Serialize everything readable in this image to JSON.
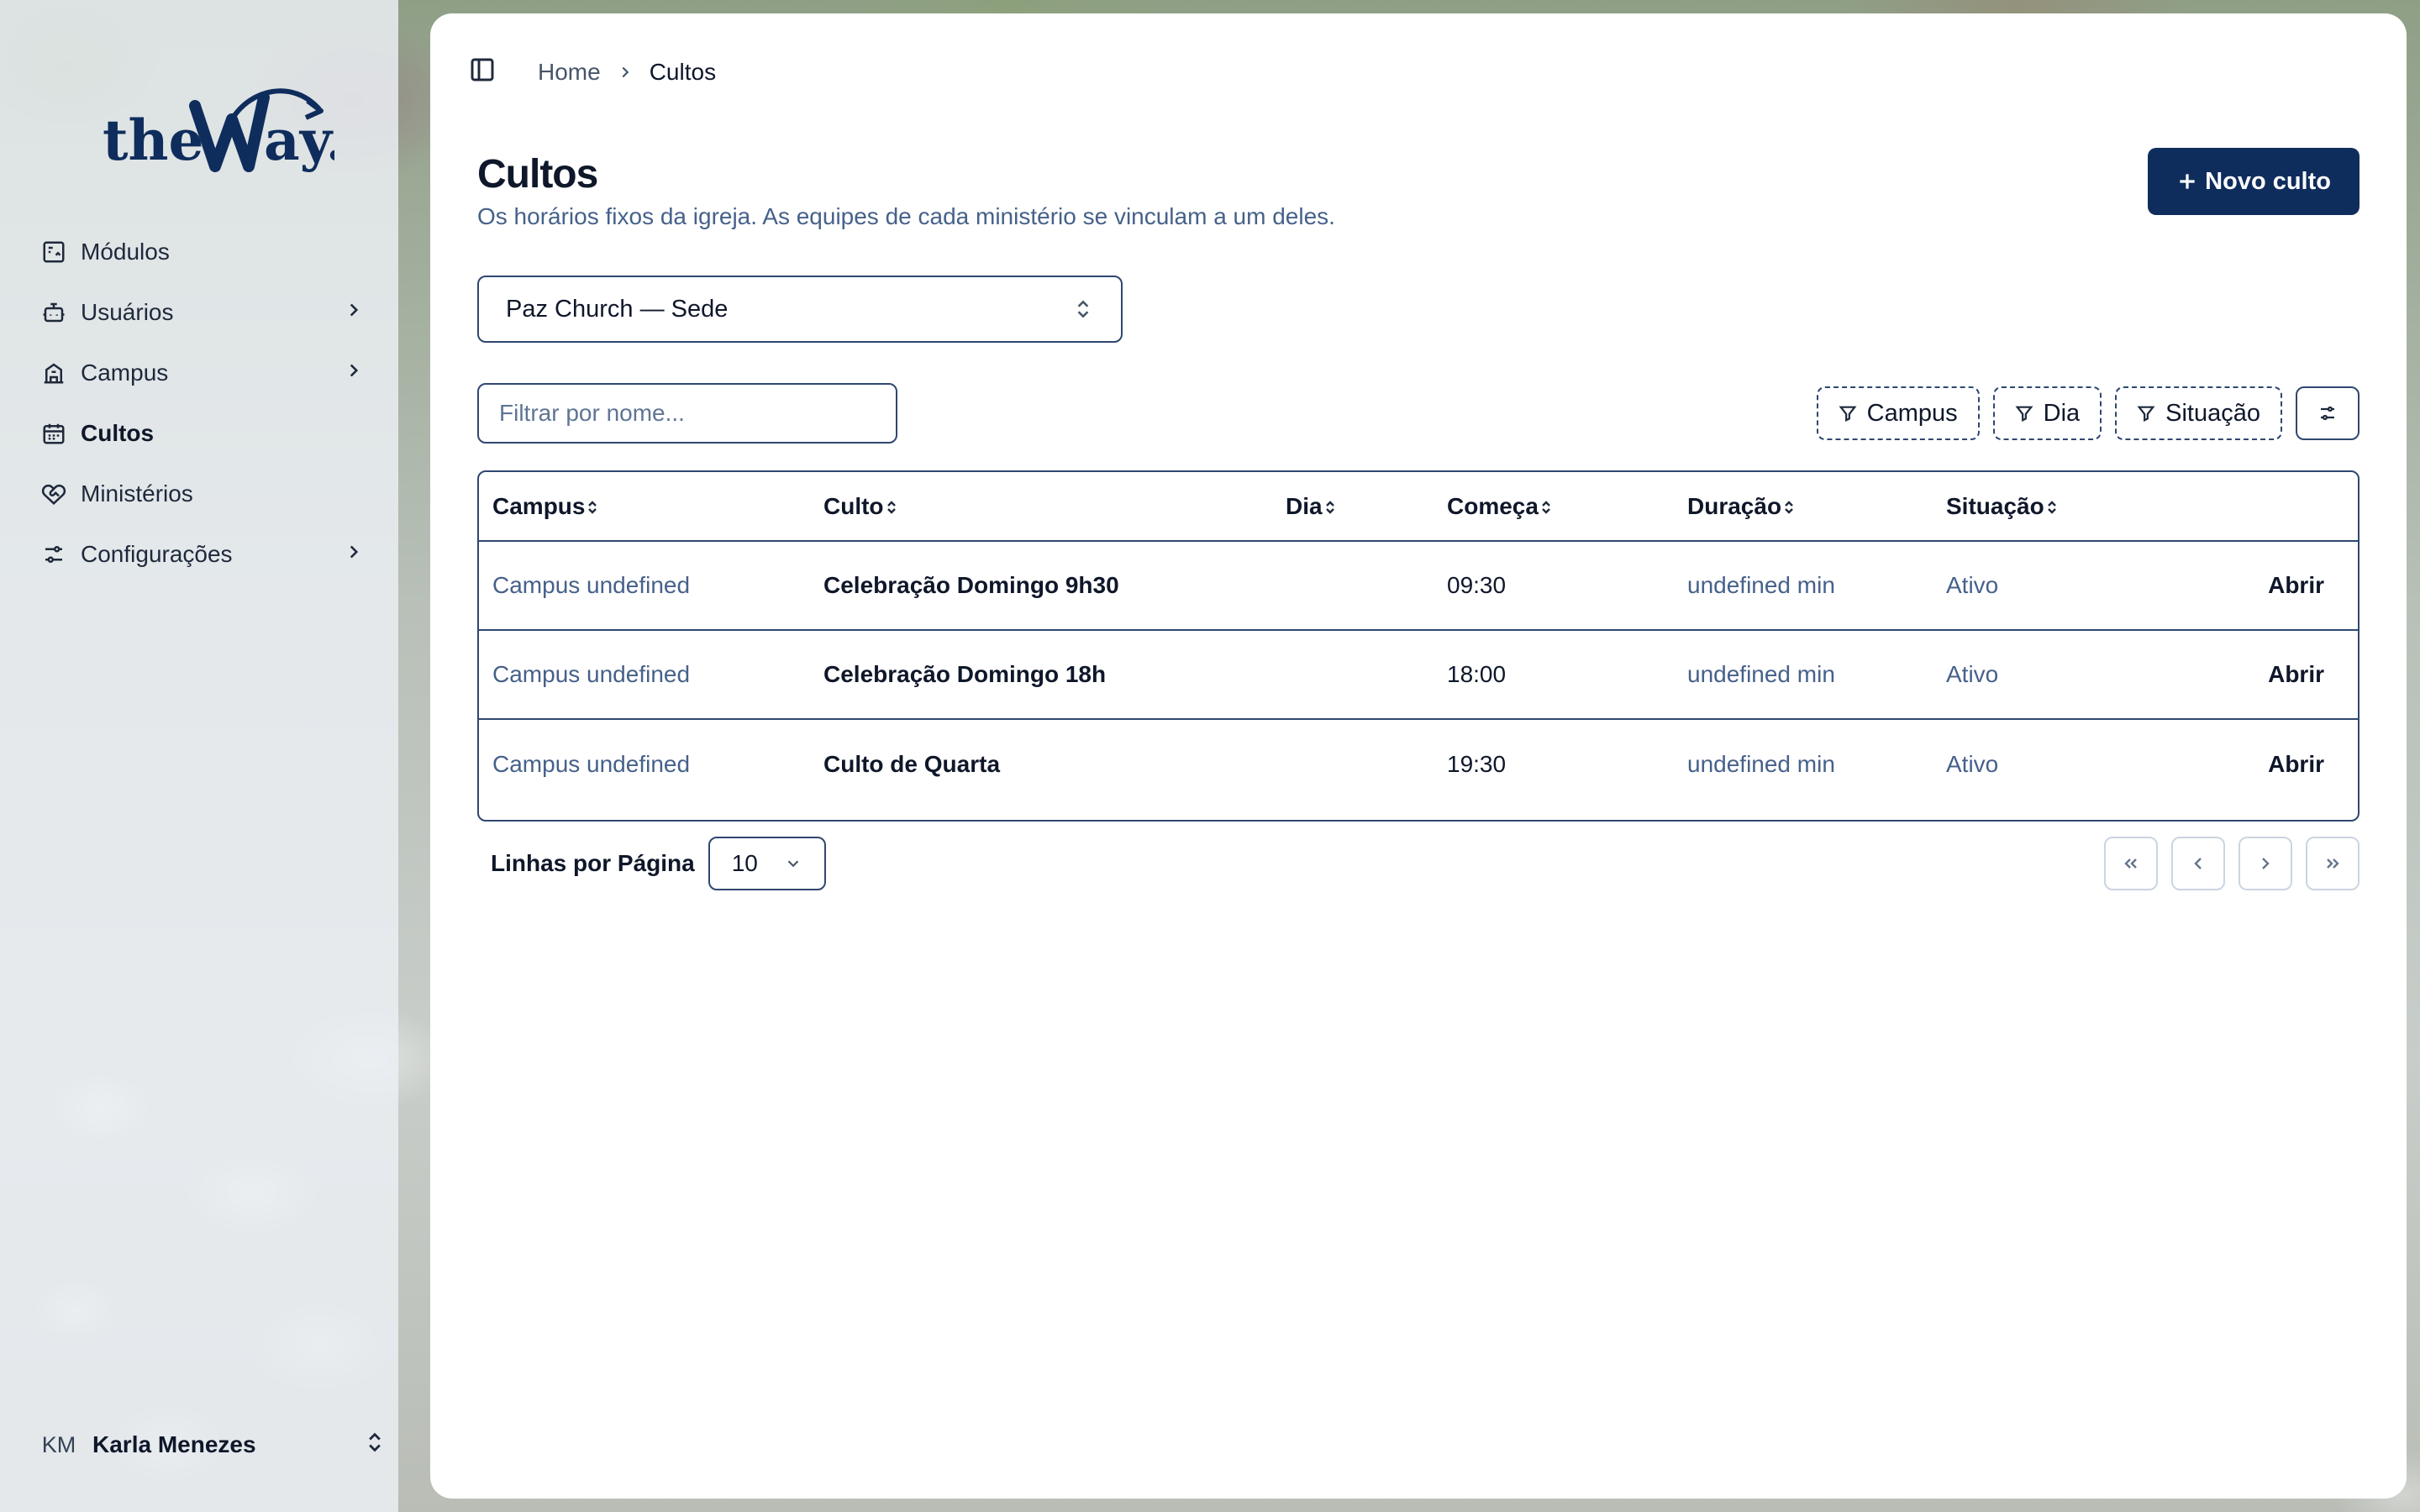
{
  "brand": {
    "logo_text": "theWay.",
    "logo_color": "#0f2d5c"
  },
  "sidebar": {
    "items": [
      {
        "label": "Módulos",
        "icon": "modules-icon",
        "has_chevron": false,
        "active": false
      },
      {
        "label": "Usuários",
        "icon": "users-bot-icon",
        "has_chevron": true,
        "active": false
      },
      {
        "label": "Campus",
        "icon": "building-icon",
        "has_chevron": true,
        "active": false
      },
      {
        "label": "Cultos",
        "icon": "calendar-icon",
        "has_chevron": false,
        "active": true
      },
      {
        "label": "Ministérios",
        "icon": "heart-handshake-icon",
        "has_chevron": false,
        "active": false
      },
      {
        "label": "Configurações",
        "icon": "settings-sliders-icon",
        "has_chevron": true,
        "active": false
      }
    ],
    "user": {
      "initials": "KM",
      "name": "Karla Menezes"
    }
  },
  "breadcrumb": {
    "home": "Home",
    "current": "Cultos"
  },
  "header": {
    "title": "Cultos",
    "subtitle": "Os horários fixos da igreja. As equipes de cada ministério se vinculam a um deles.",
    "new_button": "Novo culto"
  },
  "church_select": {
    "value": "Paz Church — Sede"
  },
  "filter": {
    "placeholder": "Filtrar por nome..."
  },
  "facets": [
    "Campus",
    "Dia",
    "Situação"
  ],
  "table": {
    "columns": [
      "Campus",
      "Culto",
      "Dia",
      "Começa",
      "Duração",
      "Situação"
    ],
    "rows": [
      {
        "campus": "Campus undefined",
        "culto": "Celebração Domingo 9h30",
        "dia": "",
        "comeca": "09:30",
        "duracao": "undefined min",
        "situacao": "Ativo",
        "action": "Abrir"
      },
      {
        "campus": "Campus undefined",
        "culto": "Celebração Domingo 18h",
        "dia": "",
        "comeca": "18:00",
        "duracao": "undefined min",
        "situacao": "Ativo",
        "action": "Abrir"
      },
      {
        "campus": "Campus undefined",
        "culto": "Culto de Quarta",
        "dia": "",
        "comeca": "19:30",
        "duracao": "undefined min",
        "situacao": "Ativo",
        "action": "Abrir"
      }
    ]
  },
  "pagination": {
    "rows_label": "Linhas por Página",
    "rows_value": "10"
  },
  "colors": {
    "primary": "#0f2d5c",
    "border": "#2f4770",
    "muted_text": "#46618a"
  }
}
